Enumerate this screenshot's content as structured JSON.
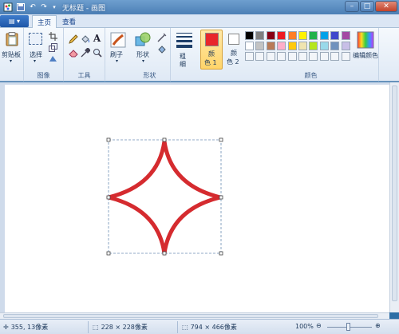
{
  "title_bar": {
    "title": "无标题 - 画图",
    "quick_access": [
      "save-icon",
      "undo-icon",
      "redo-icon",
      "dropdown-icon"
    ]
  },
  "tabs": [
    {
      "label": "主页",
      "active": true
    },
    {
      "label": "查看",
      "active": false
    }
  ],
  "ribbon": {
    "clipboard": {
      "button_label": "剪贴板",
      "group_label": ""
    },
    "image": {
      "select_label": "选择",
      "group_label": "图像"
    },
    "tools": {
      "group_label": "工具"
    },
    "shapes": {
      "brushes_label": "刷子",
      "shapes_label": "形状",
      "group_label": "形状"
    },
    "size": {
      "label_line1": "粗",
      "label_line2": "细"
    },
    "color1": {
      "label_line1": "颜",
      "label_line2": "色 1",
      "value": "#e8262b"
    },
    "color2": {
      "label_line1": "颜",
      "label_line2": "色 2",
      "value": "#ffffff"
    },
    "colors": {
      "group_label": "颜色",
      "edit_label": "编辑颜色",
      "palette_row1": [
        "#000000",
        "#7f7f7f",
        "#880015",
        "#ed1c24",
        "#ff7f27",
        "#fff200",
        "#22b14c",
        "#00a2e8",
        "#3f48cc",
        "#a349a4"
      ],
      "palette_row2": [
        "#ffffff",
        "#c3c3c3",
        "#b97a57",
        "#ffaec9",
        "#ffc90e",
        "#efe4b0",
        "#b5e61d",
        "#99d9ea",
        "#7092be",
        "#c8bfe7"
      ]
    }
  },
  "canvas": {
    "star_color": "#d52b2f"
  },
  "status_bar": {
    "cursor_pos": "355, 13像素",
    "selection_size": "228 × 228像素",
    "image_size": "794 × 466像素",
    "zoom": "100%"
  }
}
